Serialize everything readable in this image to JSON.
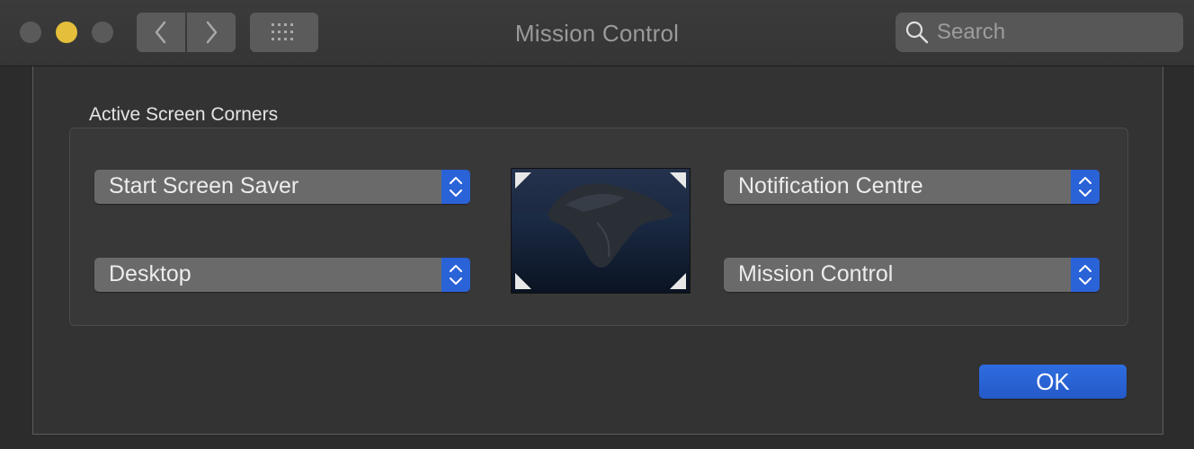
{
  "window": {
    "title": "Mission Control",
    "search_placeholder": "Search"
  },
  "corners": {
    "section_label": "Active Screen Corners",
    "top_left": "Start Screen Saver",
    "bottom_left": "Desktop",
    "top_right": "Notification Centre",
    "bottom_right": "Mission Control"
  },
  "buttons": {
    "ok": "OK"
  },
  "icons": {
    "back": "chevron-left-icon",
    "forward": "chevron-right-icon",
    "show_all": "grid-icon",
    "search": "search-icon",
    "stepper": "up-down-chevron-icon"
  },
  "colors": {
    "accent": "#2a62d8",
    "minimize": "#e5bf3c"
  }
}
